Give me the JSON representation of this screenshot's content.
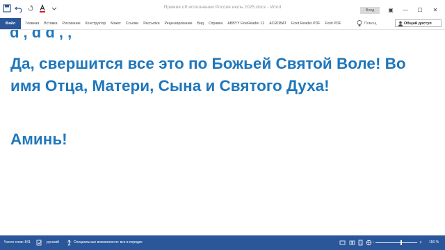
{
  "title_bar": {
    "document_title": "Премия об исполнении Россия июль 2025.docx - Word",
    "sign_in": "Вход",
    "controls": {
      "minimize": "—",
      "maximize": "☐",
      "close": "✕",
      "ribbon_options": "▣"
    }
  },
  "ribbon": {
    "file_tab": "Файл",
    "tabs": [
      "Главная",
      "Вставка",
      "Рисование",
      "Конструктор",
      "Макет",
      "Ссылки",
      "Рассылки",
      "Рецензирование",
      "Вид",
      "Справка",
      "ABBYY FineReader 12",
      "ACROBAT",
      "Foxit Reader PDF",
      "Foxit PDF"
    ],
    "help_label": "Помощ",
    "share_label": "Общий доступ"
  },
  "document": {
    "partial_line": "ԁ   ,   ԁ   ԁ   ,   ,",
    "paragraph": "Да, свершится все это по Божьей Святой Воле! Во имя Отца, Матери, Сына и Святого Духа!",
    "amen": "Аминь!"
  },
  "status_bar": {
    "word_count": "Число слов: 841",
    "language": "русский",
    "accessibility": "Специальные возможности: все в порядке",
    "zoom_level": "150 %",
    "zoom_minus": "-",
    "zoom_plus": "+"
  },
  "colors": {
    "accent": "#2b579a",
    "text_blue": "#1f77bc"
  }
}
